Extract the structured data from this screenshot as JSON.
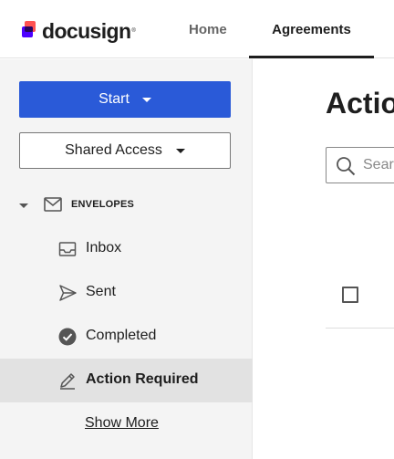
{
  "header": {
    "logo_text": "docusign",
    "logo_tm": "®",
    "nav": [
      {
        "label": "Home"
      },
      {
        "label": "Agreements"
      }
    ]
  },
  "sidebar": {
    "start_label": "Start",
    "shared_access_label": "Shared Access",
    "envelopes_label": "ENVELOPES",
    "items": [
      {
        "label": "Inbox",
        "icon": "inbox-icon"
      },
      {
        "label": "Sent",
        "icon": "send-icon"
      },
      {
        "label": "Completed",
        "icon": "check-circle-icon"
      },
      {
        "label": "Action Required",
        "icon": "pen-icon"
      }
    ],
    "show_more_label": "Show More"
  },
  "main": {
    "title": "Actio",
    "search_placeholder": "Search"
  },
  "colors": {
    "primary_button": "#2a5ad8",
    "sidebar_bg": "#f4f4f4",
    "selected_bg": "#e2e2e2",
    "logo_red": "#ff5252",
    "logo_purple": "#4c00ff"
  }
}
